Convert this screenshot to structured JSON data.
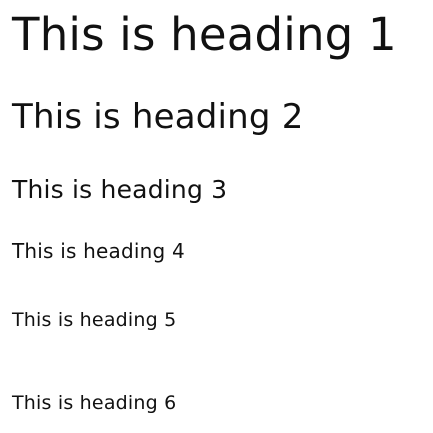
{
  "headings": [
    {
      "level": 1,
      "text": "This is heading 1"
    },
    {
      "level": 2,
      "text": "This is heading 2"
    },
    {
      "level": 3,
      "text": "This is heading 3"
    },
    {
      "level": 4,
      "text": "This is heading 4"
    },
    {
      "level": 5,
      "text": "This is heading 5"
    },
    {
      "level": 6,
      "text": "This is heading 6"
    }
  ],
  "colors": {
    "text": "#111111",
    "background": "#ffffff"
  }
}
